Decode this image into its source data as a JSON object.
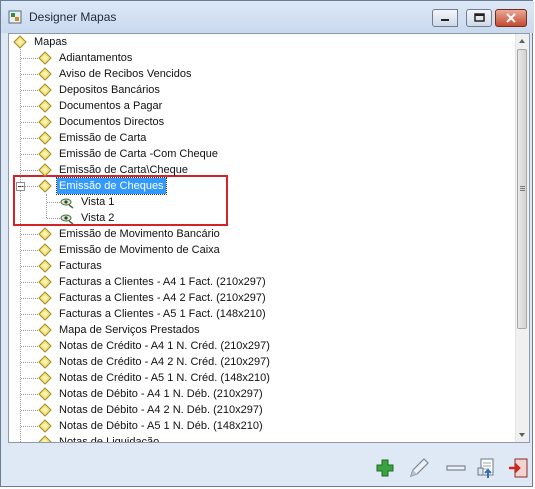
{
  "window": {
    "title": "Designer Mapas"
  },
  "tree": {
    "root": {
      "label": "Mapas"
    },
    "items": [
      {
        "label": "Adiantamentos"
      },
      {
        "label": "Aviso de Recibos Vencidos"
      },
      {
        "label": "Depositos Bancários"
      },
      {
        "label": "Documentos a Pagar"
      },
      {
        "label": "Documentos Directos"
      },
      {
        "label": "Emissão de Carta"
      },
      {
        "label": "Emissão de Carta -Com Cheque"
      },
      {
        "label": "Emissão de Carta\\Cheque"
      },
      {
        "label": "Emissão de Cheques",
        "children": [
          {
            "label": "Vista 1"
          },
          {
            "label": "Vista 2"
          }
        ]
      },
      {
        "label": "Emissão de Movimento Bancário"
      },
      {
        "label": "Emissão de Movimento de Caixa"
      },
      {
        "label": "Facturas"
      },
      {
        "label": "Facturas a Clientes - A4  1 Fact. (210x297)"
      },
      {
        "label": "Facturas a Clientes - A4  2 Fact. (210x297)"
      },
      {
        "label": "Facturas a Clientes - A5  1 Fact. (148x210)"
      },
      {
        "label": "Mapa de Serviços Prestados"
      },
      {
        "label": "Notas de Crédito - A4  1 N. Créd. (210x297)"
      },
      {
        "label": "Notas de Crédito - A4  2 N. Créd. (210x297)"
      },
      {
        "label": "Notas de Crédito - A5  1 N. Créd. (148x210)"
      },
      {
        "label": "Notas de Débito - A4  1 N. Déb. (210x297)"
      },
      {
        "label": "Notas de Débito - A4  2 N. Déb. (210x297)"
      },
      {
        "label": "Notas de Débito - A5  1 N. Déb. (148x210)"
      },
      {
        "label": "Notas de Liquidação"
      }
    ]
  },
  "toolbar": {
    "buttons": [
      {
        "icon": "add-icon"
      },
      {
        "icon": "edit-icon"
      },
      {
        "icon": "remove-icon"
      },
      {
        "icon": "import-icon"
      },
      {
        "icon": "exit-icon"
      }
    ]
  },
  "colors": {
    "selection": "#3399ff",
    "highlight_border": "#d42227",
    "diamond_fill": "#f7e27a"
  }
}
